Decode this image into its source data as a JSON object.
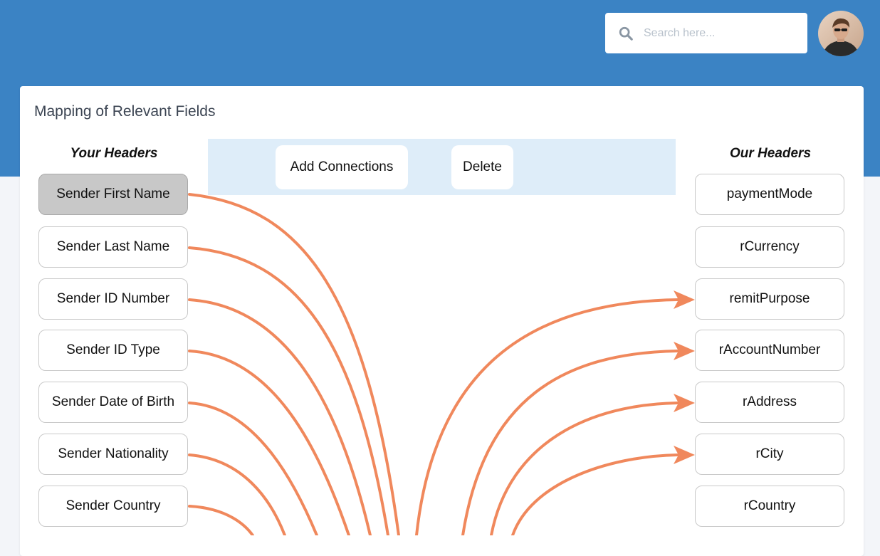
{
  "search": {
    "placeholder": "Search here..."
  },
  "card": {
    "title": "Mapping of Relevant Fields",
    "left_heading": "Your Headers",
    "right_heading": "Our Headers"
  },
  "toolbar": {
    "add_label": "Add Connections",
    "delete_label": "Delete"
  },
  "your_headers": [
    "Sender First Name",
    "Sender Last Name",
    "Sender ID Number",
    "Sender ID Type",
    "Sender Date of Birth",
    "Sender Nationality",
    "Sender Country"
  ],
  "our_headers": [
    "paymentMode",
    "rCurrency",
    "remitPurpose",
    "rAccountNumber",
    "rAddress",
    "rCity",
    "rCountry"
  ],
  "selected_left_index": 0,
  "colors": {
    "header_bg": "#3b83c4",
    "connector": "#f0885c",
    "toolbar_bg": "#deedf9",
    "selected_field": "#c8c8c8"
  }
}
